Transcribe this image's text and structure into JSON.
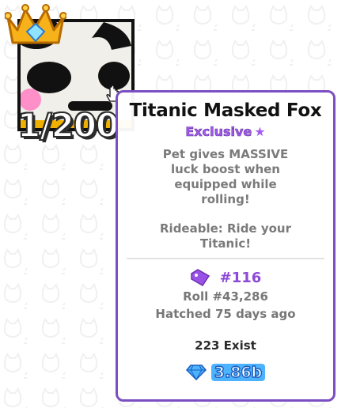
{
  "pet": {
    "counter_text": "1/200"
  },
  "tooltip": {
    "title": "Titanic Masked Fox",
    "rarity": "Exclusive",
    "rarity_icon": "star-icon",
    "description": "Pet gives MASSIVE luck boost when equipped while rolling!",
    "description2": "Rideable: Ride your Titanic!",
    "tag_number": "#116",
    "roll": "Roll #43,286",
    "hatched": "Hatched 75 days ago",
    "exist": "223 Exist",
    "value": "3.86b"
  },
  "colors": {
    "border": "#7b4fc2",
    "rarity": "#a35cf0",
    "value": "#4db3ff"
  }
}
